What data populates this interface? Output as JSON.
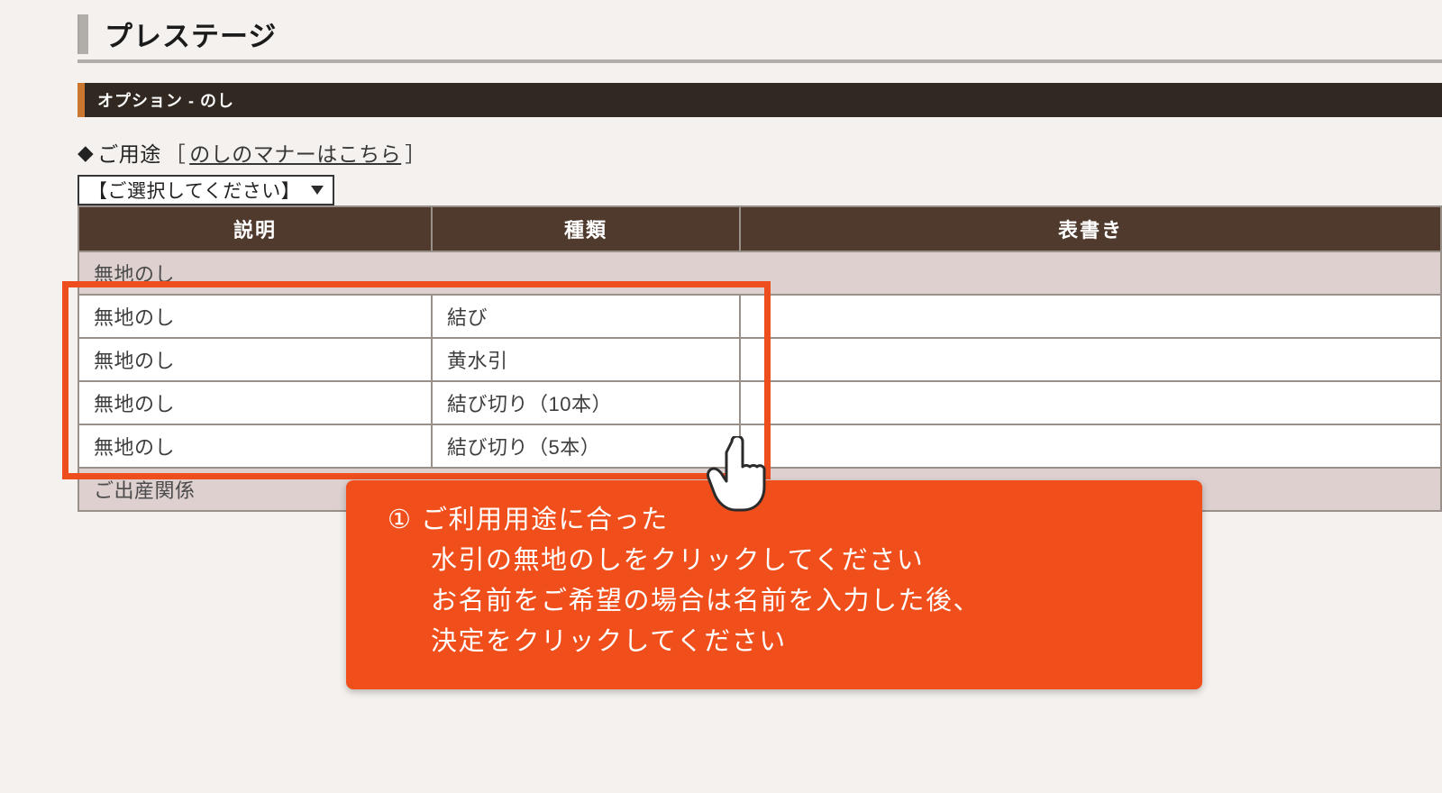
{
  "page_title": "プレステージ",
  "section_title": "オプション - のし",
  "prompt_diamond": "◆",
  "prompt_label": "ご用途",
  "prompt_link": "のしのマナーはこちら",
  "select_placeholder": "【ご選択してください】",
  "columns": {
    "desc": "説明",
    "type": "種類",
    "title_col": "表書き"
  },
  "category_a": "無地のし",
  "rows": [
    {
      "desc": "無地のし",
      "type": "結び"
    },
    {
      "desc": "無地のし",
      "type": "黄水引"
    },
    {
      "desc": "無地のし",
      "type": "結び切り（10本）"
    },
    {
      "desc": "無地のし",
      "type": "結び切り（5本）"
    }
  ],
  "category_b": "ご出産関係",
  "callout": {
    "num": "①",
    "l1": "ご利用用途に合った",
    "l2": "水引の無地のしをクリックしてください",
    "l3": "お名前をご希望の場合は名前を入力した後、",
    "l4": "決定をクリックしてください"
  }
}
